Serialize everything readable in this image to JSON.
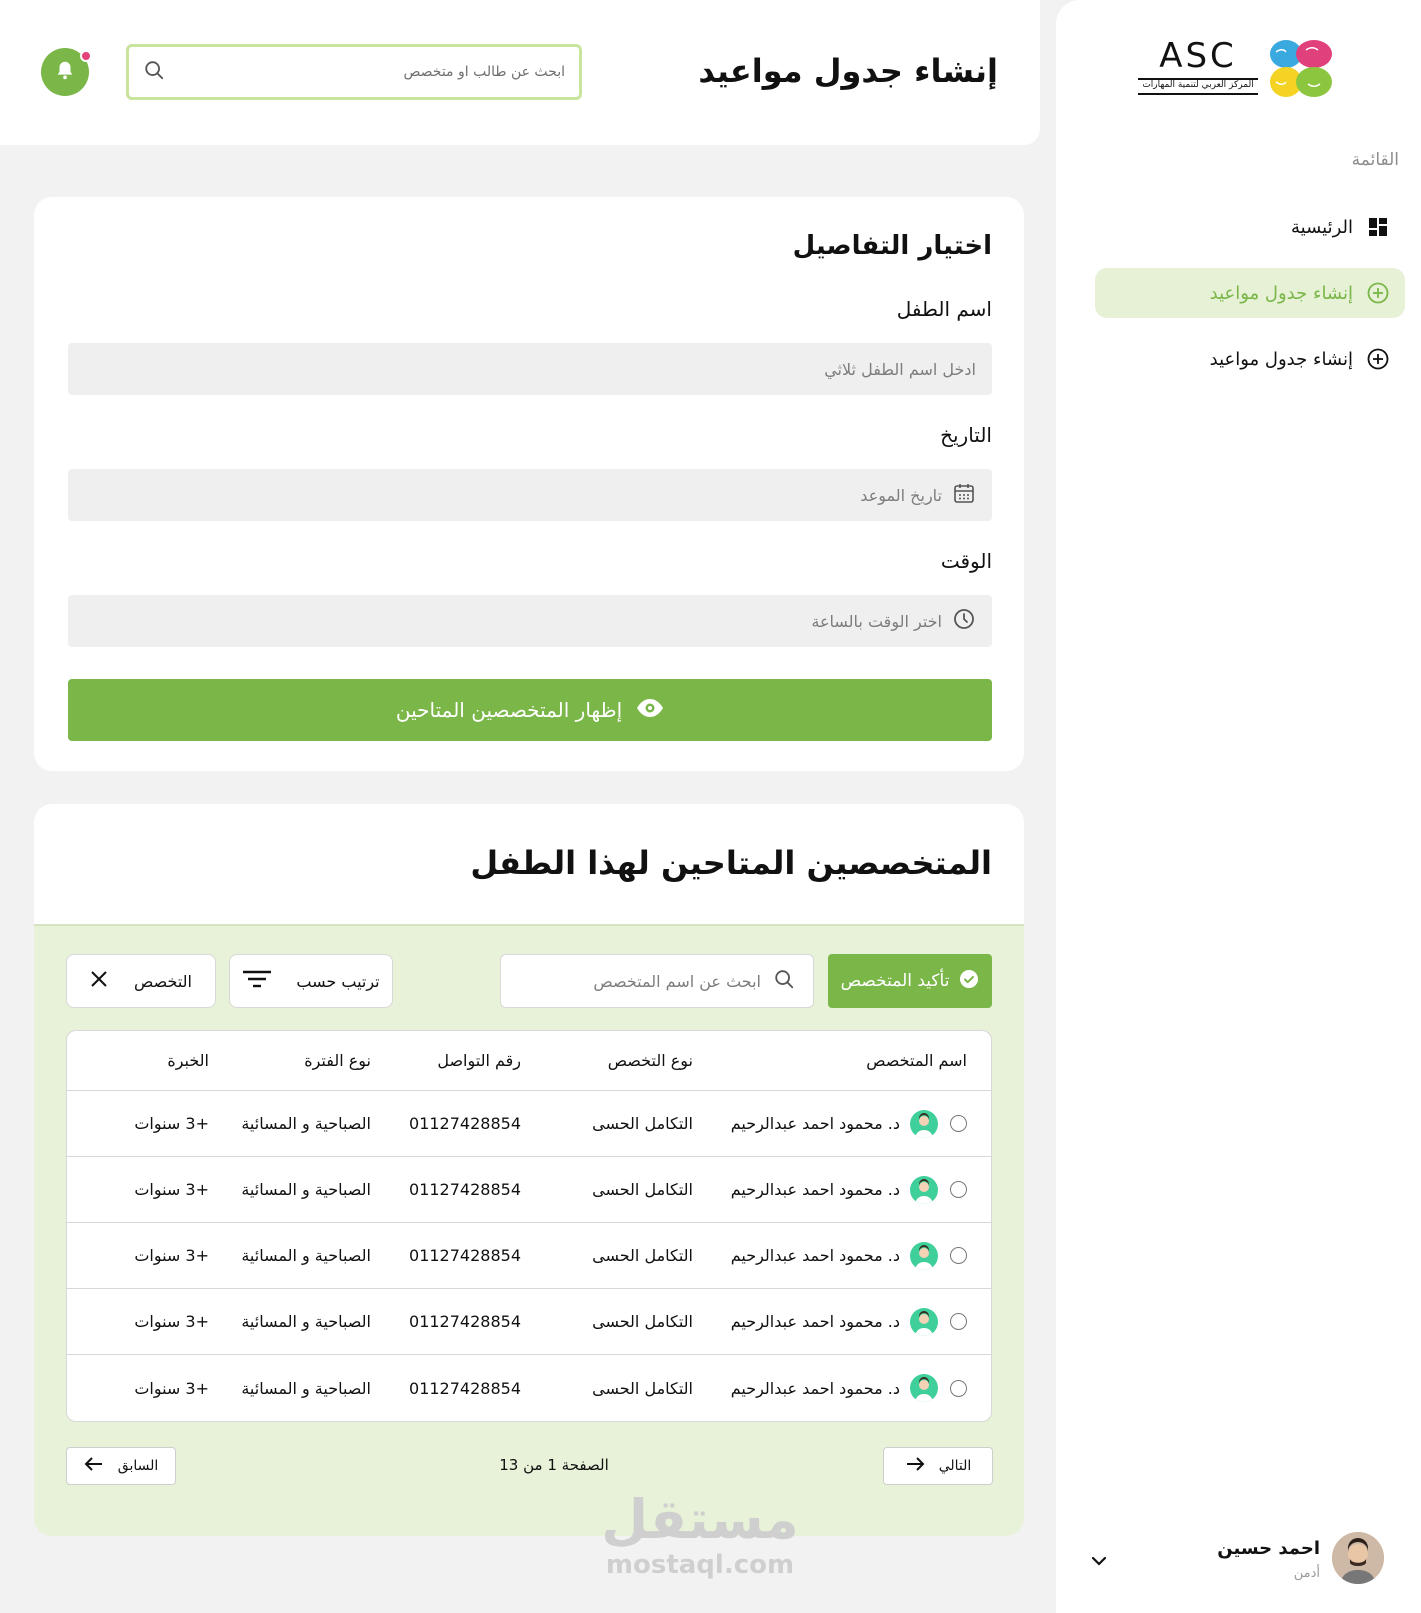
{
  "header": {
    "title": "إنشاء جدول مواعيد",
    "search_placeholder": "ابحث عن طالب او متخصص"
  },
  "sidebar": {
    "logo_text": "ASC",
    "logo_subtitle": "المركز العربي لتنمية المهارات",
    "menu_title": "القائمة",
    "items": [
      {
        "label": "الرئيسية",
        "icon": "dashboard-icon"
      },
      {
        "label": "إنشاء جدول مواعيد",
        "icon": "plus-circle-icon",
        "active": true
      },
      {
        "label": "إنشاء جدول مواعيد",
        "icon": "plus-circle-icon"
      }
    ],
    "user": {
      "name": "احمد حسين",
      "role": "أدمن"
    }
  },
  "details": {
    "title": "اختيار التفاصيل",
    "child_label": "اسم الطفل",
    "child_placeholder": "ادخل اسم الطفل ثلاثي",
    "date_label": "التاريخ",
    "date_placeholder": "تاريخ الموعد",
    "time_label": "الوقت",
    "time_placeholder": "اختر الوقت بالساعة",
    "show_button": "إظهار المتخصصين المتاحين"
  },
  "specialists": {
    "title": "المتخصصين المتاحين لهذا الطفل",
    "confirm_button": "تأكيد المتخصص",
    "search_placeholder": "ابحث عن اسم المتخصص",
    "sort_button": "ترتيب حسب",
    "filter_chip": "التخصص",
    "columns": [
      "اسم المتخصص",
      "نوع التخصص",
      "رقم التواصل",
      "نوع الفترة",
      "الخبرة"
    ],
    "rows": [
      {
        "name": "د. محمود احمد عبدالرحيم",
        "type": "التكامل الحسى",
        "phone": "01127428854",
        "period": "الصباحية و المسائية",
        "experience": "+3 سنوات"
      },
      {
        "name": "د. محمود احمد عبدالرحيم",
        "type": "التكامل الحسى",
        "phone": "01127428854",
        "period": "الصباحية و المسائية",
        "experience": "+3 سنوات"
      },
      {
        "name": "د. محمود احمد عبدالرحيم",
        "type": "التكامل الحسى",
        "phone": "01127428854",
        "period": "الصباحية و المسائية",
        "experience": "+3 سنوات"
      },
      {
        "name": "د. محمود احمد عبدالرحيم",
        "type": "التكامل الحسى",
        "phone": "01127428854",
        "period": "الصباحية و المسائية",
        "experience": "+3 سنوات"
      },
      {
        "name": "د. محمود احمد عبدالرحيم",
        "type": "التكامل الحسى",
        "phone": "01127428854",
        "period": "الصباحية و المسائية",
        "experience": "+3 سنوات"
      }
    ],
    "pagination": {
      "next": "التالي",
      "prev": "السابق",
      "info": "الصفحة 1 من 13"
    }
  },
  "watermark": {
    "ar": "مستقل",
    "en": "mostaql.com"
  },
  "colors": {
    "accent": "#7ab648",
    "accent_light": "#e7f2d8",
    "notification": "#e5427c"
  }
}
